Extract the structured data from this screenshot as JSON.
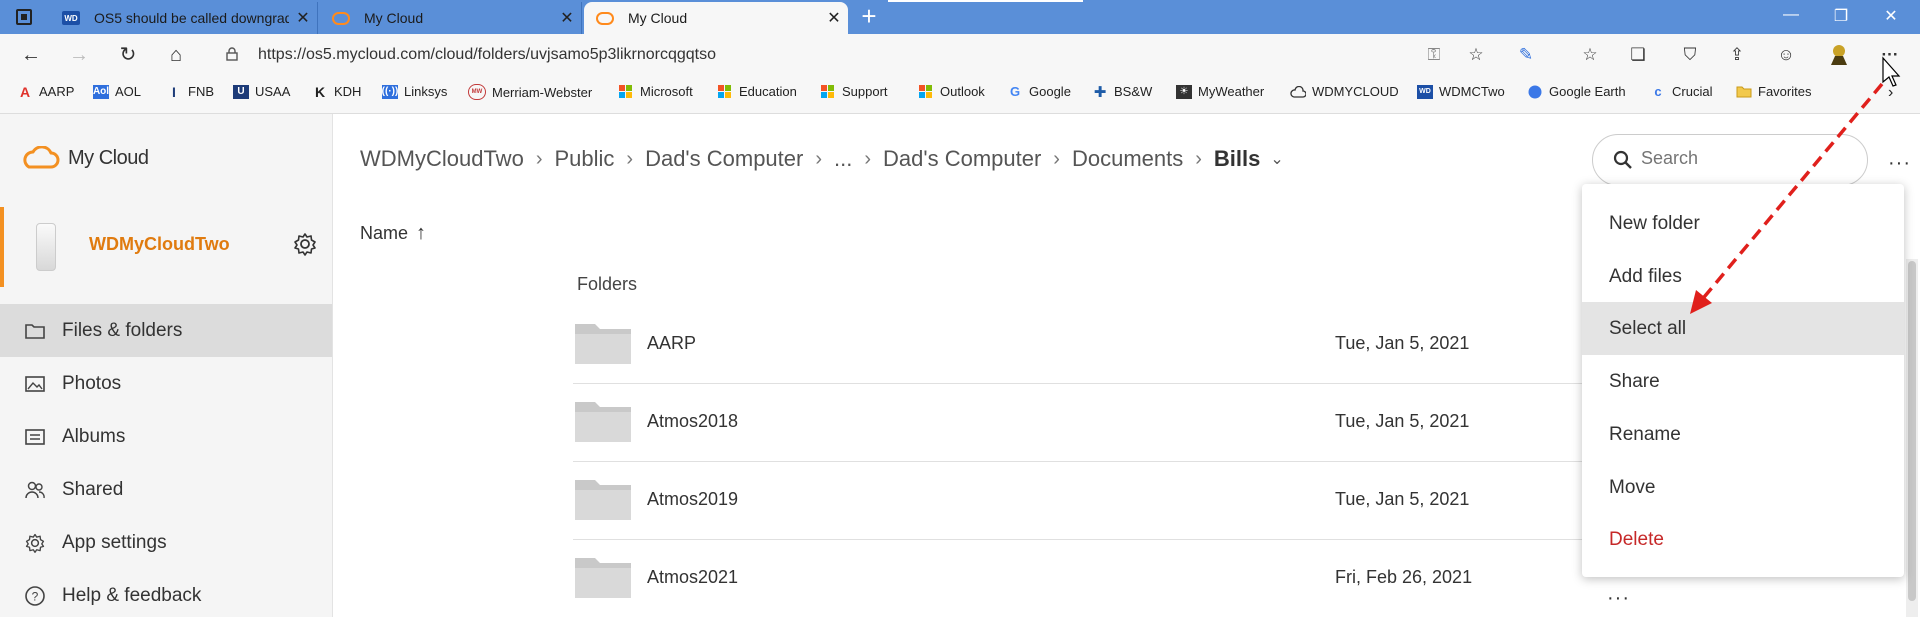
{
  "browser": {
    "tabs": [
      {
        "title": "OS5 should be called downgrade",
        "favicon": "wd-logo",
        "active": false
      },
      {
        "title": "My Cloud",
        "favicon": "mycloud-logo",
        "active": false
      },
      {
        "title": "My Cloud",
        "favicon": "mycloud-logo",
        "active": true
      }
    ],
    "url": "https://os5.mycloud.com/cloud/folders/uvjsamo5p3likrnorcqgqtso",
    "bookmarks": [
      {
        "label": "AARP",
        "color": "#e0322b"
      },
      {
        "label": "AOL",
        "color": "#2f6fdd"
      },
      {
        "label": "FNB",
        "color": "#1d3b78"
      },
      {
        "label": "USAA",
        "color": "#1d3b78"
      },
      {
        "label": "KDH",
        "color": "#222222"
      },
      {
        "label": "Linksys",
        "color": "#2f6fdd"
      },
      {
        "label": "Merriam-Webster",
        "color": "#c23a3a"
      },
      {
        "label": "Microsoft",
        "color": "#f35325"
      },
      {
        "label": "Education",
        "color": "#f35325"
      },
      {
        "label": "Support",
        "color": "#f35325"
      },
      {
        "label": "Outlook",
        "color": "#f35325"
      },
      {
        "label": "Google",
        "color": "#4285f4"
      },
      {
        "label": "BS&W",
        "color": "#1e5ca8"
      },
      {
        "label": "MyWeather",
        "color": "#333333"
      },
      {
        "label": "WDMYCLOUD",
        "color": "#333333"
      },
      {
        "label": "WDMCTwo",
        "color": "#1c4fa6"
      },
      {
        "label": "Google Earth",
        "color": "#3b78e7"
      },
      {
        "label": "Crucial",
        "color": "#3b78e7"
      },
      {
        "label": "Favorites",
        "color": "#f2c94c"
      }
    ]
  },
  "app": {
    "logo_text": "My Cloud",
    "accent": "#f39021",
    "device_name": "WDMyCloudTwo",
    "nav": [
      {
        "label": "Files & folders",
        "icon": "folder-icon",
        "selected": true
      },
      {
        "label": "Photos",
        "icon": "image-icon",
        "selected": false
      },
      {
        "label": "Albums",
        "icon": "album-icon",
        "selected": false
      },
      {
        "label": "Shared",
        "icon": "people-icon",
        "selected": false
      },
      {
        "label": "App settings",
        "icon": "gear-icon",
        "selected": false
      },
      {
        "label": "Help & feedback",
        "icon": "help-icon",
        "selected": false
      }
    ],
    "breadcrumb": [
      "WDMyCloudTwo",
      "Public",
      "Dad's Computer",
      "...",
      "Dad's Computer",
      "Documents",
      "Bills"
    ],
    "search_placeholder": "Search",
    "sort_label": "Name",
    "section_label": "Folders",
    "folders": [
      {
        "name": "AARP",
        "date": "Tue, Jan 5, 2021"
      },
      {
        "name": "Atmos2018",
        "date": "Tue, Jan 5, 2021"
      },
      {
        "name": "Atmos2019",
        "date": "Tue, Jan 5, 2021"
      },
      {
        "name": "Atmos2021",
        "date": "Fri, Feb 26, 2021"
      }
    ],
    "menu": [
      {
        "label": "New folder"
      },
      {
        "label": "Add files"
      },
      {
        "label": "Select all",
        "hover": true
      },
      {
        "label": "Share"
      },
      {
        "label": "Rename"
      },
      {
        "label": "Move"
      },
      {
        "label": "Delete",
        "danger": true
      }
    ]
  }
}
